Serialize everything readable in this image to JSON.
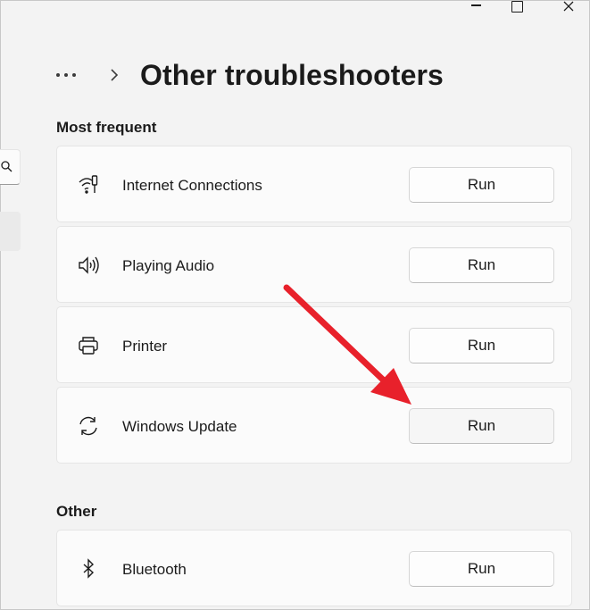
{
  "header": {
    "title": "Other troubleshooters"
  },
  "sections": {
    "most_frequent": "Most frequent",
    "other": "Other"
  },
  "items": [
    {
      "label": "Internet Connections",
      "icon": "wifi-icon",
      "button": "Run"
    },
    {
      "label": "Playing Audio",
      "icon": "speaker-icon",
      "button": "Run"
    },
    {
      "label": "Printer",
      "icon": "printer-icon",
      "button": "Run"
    },
    {
      "label": "Windows Update",
      "icon": "sync-icon",
      "button": "Run"
    },
    {
      "label": "Bluetooth",
      "icon": "bluetooth-icon",
      "button": "Run"
    }
  ],
  "colors": {
    "background": "#f3f3f3",
    "card": "#fbfbfb",
    "annotation_arrow": "#e8212b"
  }
}
